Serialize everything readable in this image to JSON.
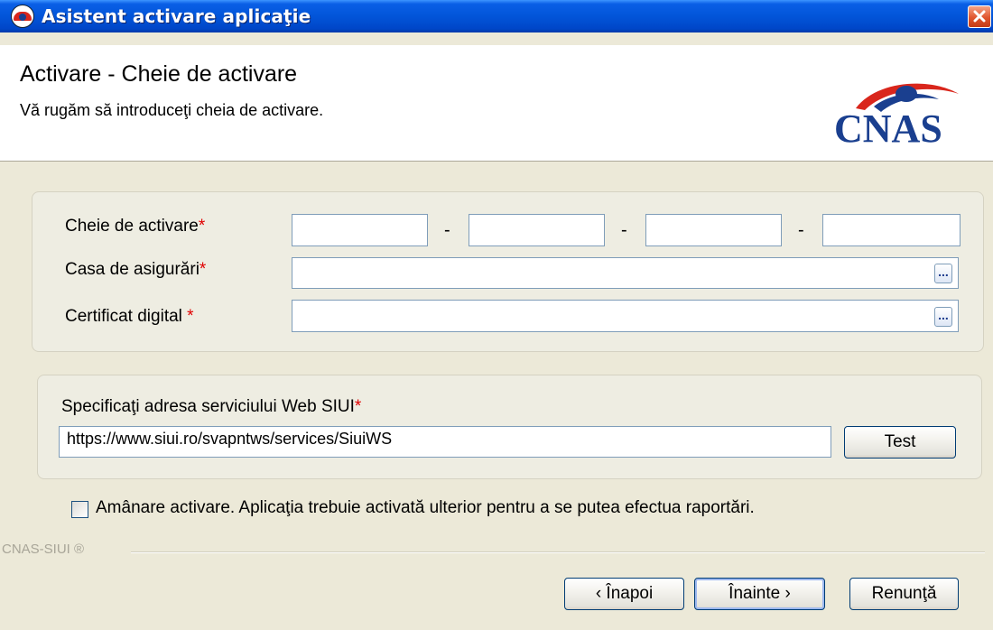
{
  "window": {
    "title": "Asistent activare aplicaţie"
  },
  "header": {
    "title": "Activare - Cheie de activare",
    "subtitle": "Vă rugăm să introduceţi cheia de activare.",
    "logo_text": "CNAS"
  },
  "form": {
    "activation_key_label": "Cheie de activare",
    "insurance_house_label": "Casa de asigurări",
    "certificate_label": "Certificat digital",
    "required_marker": "*",
    "separator": "-",
    "browse_label": "...",
    "activation_key_values": [
      "",
      "",
      "",
      ""
    ],
    "insurance_house_value": "",
    "certificate_value": ""
  },
  "web_service": {
    "label": "Specificaţi adresa serviciului Web SIUI",
    "url": "https://www.siui.ro/svapntws/services/SiuiWS",
    "test_button": "Test"
  },
  "defer": {
    "label": "Amânare activare. Aplicaţia trebuie activată ulterior pentru a se putea efectua raportări.",
    "checked": false
  },
  "footer": {
    "brand": "CNAS-SIUI ®",
    "back_button": "‹ Înapoi",
    "next_button": "Înainte ›",
    "cancel_button": "Renunţă"
  },
  "colors": {
    "title_bar": "#0255D9",
    "window_bg": "#ECE9D8",
    "required": "#E00000",
    "logo_blue": "#1A3F8F",
    "logo_red": "#D9261C"
  }
}
